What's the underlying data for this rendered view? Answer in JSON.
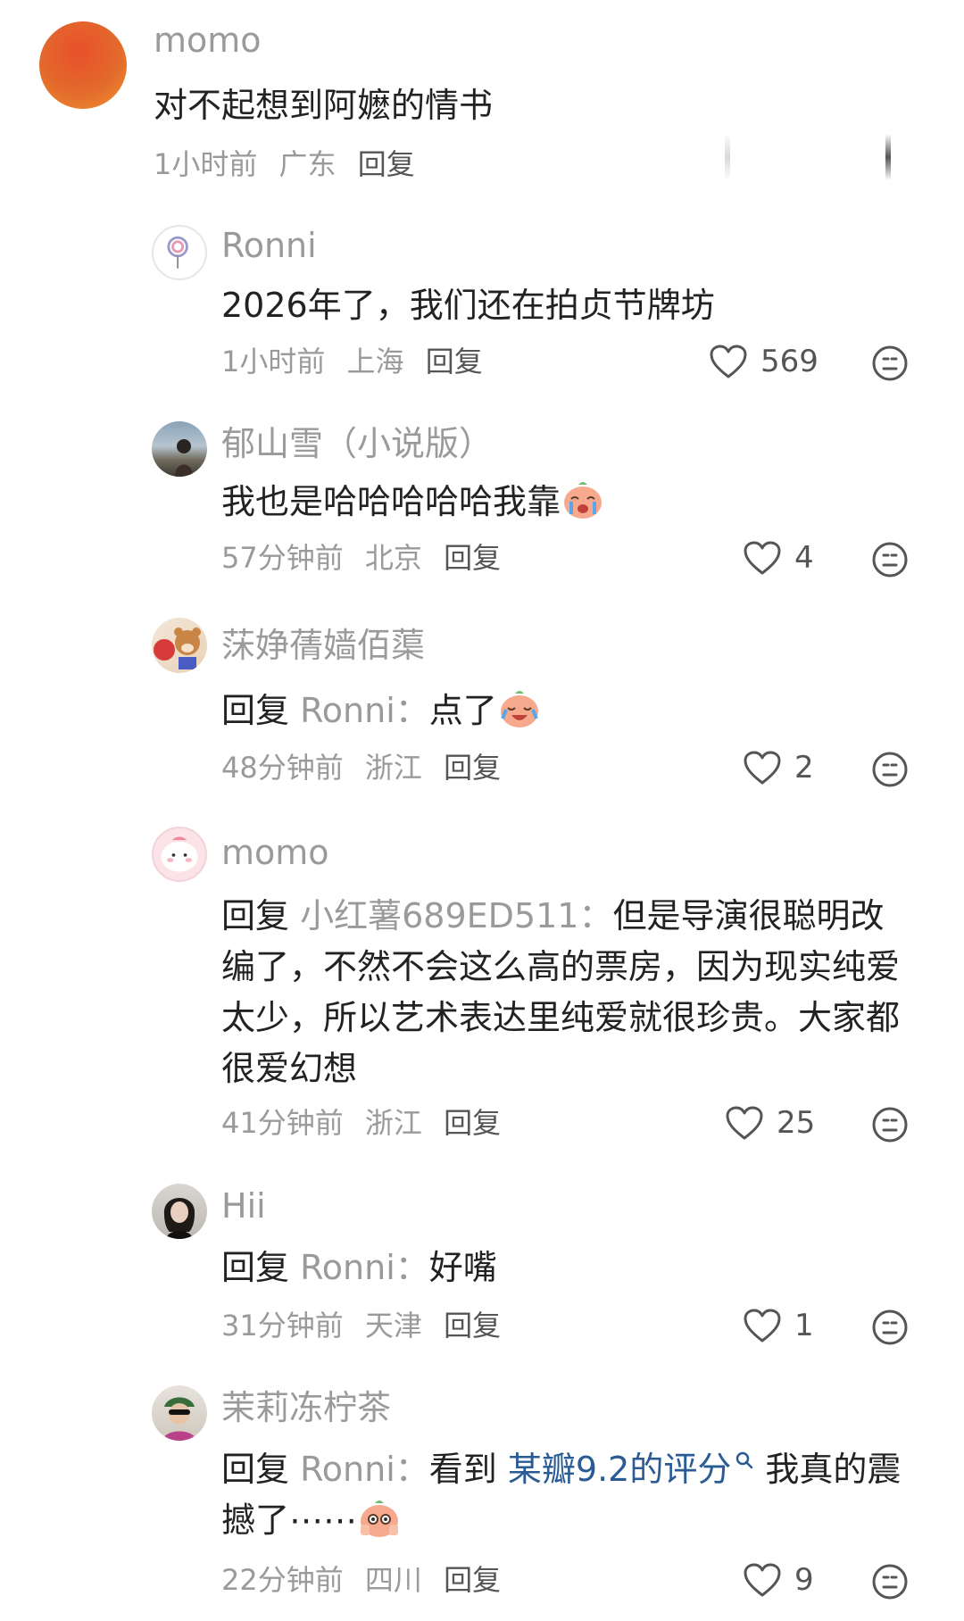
{
  "top_comment": {
    "username": "momo",
    "text": "对不起想到阿嬷的情书",
    "time": "1小时前",
    "location": "广东",
    "reply_label": "回复"
  },
  "replies": [
    {
      "username": "Ronni",
      "text": "2026年了，我们还在拍贞节牌坊",
      "time": "1小时前",
      "location": "上海",
      "reply_label": "回复",
      "likes": "569"
    },
    {
      "username": "郁山雪（小说版）",
      "text": "我也是哈哈哈哈哈我靠",
      "time": "57分钟前",
      "location": "北京",
      "reply_label": "回复",
      "likes": "4"
    },
    {
      "username": "莯婙蒨嫱佰蕖",
      "reply_prefix": "回复",
      "reply_target": "Ronni：",
      "text": "点了",
      "time": "48分钟前",
      "location": "浙江",
      "reply_label": "回复",
      "likes": "2"
    },
    {
      "username": "momo",
      "reply_prefix": "回复",
      "reply_target": "小红薯689ED511：",
      "text": "但是导演很聪明改编了，不然不会这么高的票房，因为现实纯爱太少，所以艺术表达里纯爱就很珍贵。大家都很爱幻想",
      "time": "41分钟前",
      "location": "浙江",
      "reply_label": "回复",
      "likes": "25"
    },
    {
      "username": "Hii",
      "reply_prefix": "回复",
      "reply_target": "Ronni：",
      "text": "好嘴",
      "time": "31分钟前",
      "location": "天津",
      "reply_label": "回复",
      "likes": "1"
    },
    {
      "username": "茉莉冻柠茶",
      "reply_prefix": "回复",
      "reply_target": "Ronni：",
      "text_before": "看到",
      "link_text": "某瓣9.2的评分",
      "text_after": "我真的震撼了⋯⋯",
      "time": "22分钟前",
      "location": "四川",
      "reply_label": "回复",
      "likes": "9"
    }
  ],
  "colors": {
    "username": "#9a9a9a",
    "text": "#222222",
    "link": "#2b5b94",
    "meta": "#9a9a9a",
    "icon": "#555555"
  },
  "icons": [
    "heart-icon",
    "emoji-react-icon",
    "search-icon",
    "crying-emoji",
    "laughing-emoji",
    "shy-emoji"
  ]
}
